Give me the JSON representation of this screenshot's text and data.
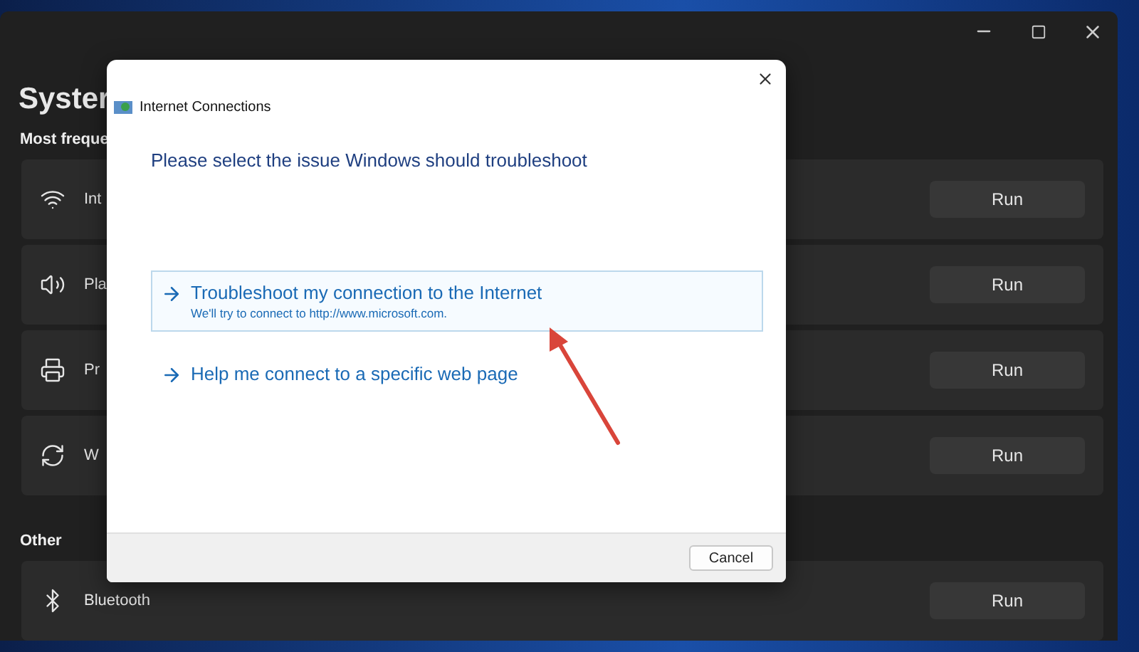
{
  "settings": {
    "title": "Syster",
    "section": "Most freque",
    "rows": [
      {
        "label": "Int",
        "button": "Run"
      },
      {
        "label": "Pla",
        "button": "Run"
      },
      {
        "label": "Pr",
        "button": "Run"
      },
      {
        "label": "W",
        "button": "Run"
      }
    ],
    "other_section": "Other",
    "other_rows": [
      {
        "label": "Bluetooth",
        "button": "Run"
      }
    ]
  },
  "dialog": {
    "title": "Internet Connections",
    "heading": "Please select the issue Windows should troubleshoot",
    "options": [
      {
        "title": "Troubleshoot my connection to the Internet",
        "description": "We'll try to connect to http://www.microsoft.com.",
        "selected": true
      },
      {
        "title": "Help me connect to a specific web page",
        "selected": false
      }
    ],
    "cancel": "Cancel"
  }
}
